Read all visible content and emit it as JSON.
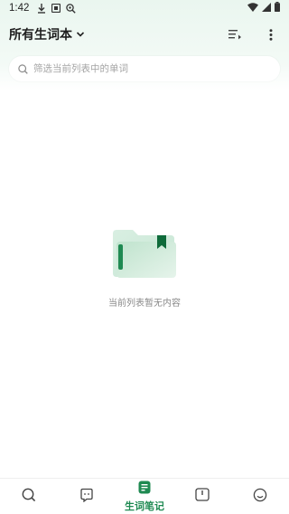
{
  "status_bar": {
    "time": "1:42",
    "left_icons": [
      "download-icon",
      "notification-box-icon",
      "search-status-icon"
    ],
    "right_icons": [
      "wifi-icon",
      "signal-icon",
      "battery-icon"
    ]
  },
  "header": {
    "title": "所有生词本",
    "dropdown_icon": "chevron-down-icon",
    "sort_icon": "sort-list-icon",
    "more_icon": "more-vertical-icon"
  },
  "search": {
    "placeholder": "筛选当前列表中的单词",
    "value": ""
  },
  "empty_state": {
    "illustration": "folder-bookmark-icon",
    "text": "当前列表暂无内容"
  },
  "bottom_nav": {
    "items": [
      {
        "icon": "search-icon",
        "label": "",
        "active": false
      },
      {
        "icon": "chat-icon",
        "label": "",
        "active": false
      },
      {
        "icon": "notebook-icon",
        "label": "生词笔记",
        "active": true
      },
      {
        "icon": "book-icon",
        "label": "",
        "active": false
      },
      {
        "icon": "smile-icon",
        "label": "",
        "active": false
      }
    ]
  },
  "colors": {
    "accent": "#1f8a52",
    "accent_dark": "#0f6b3a",
    "header_bg": "#eaf6ef",
    "icon_gray": "#444444"
  }
}
